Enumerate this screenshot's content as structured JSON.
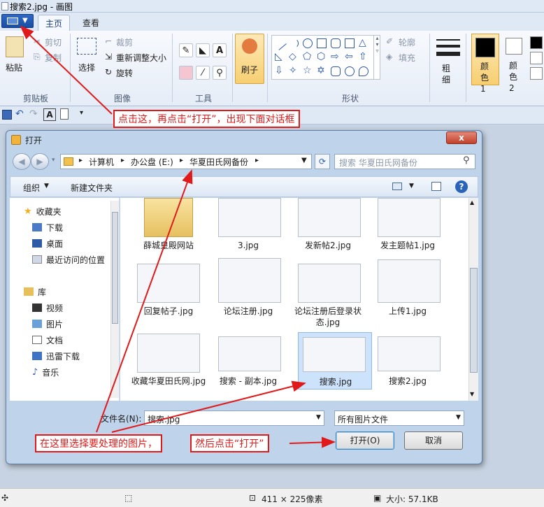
{
  "window": {
    "title": "搜索2.jpg - 画图"
  },
  "ribbon": {
    "tabs": [
      "主页",
      "查看"
    ],
    "clipboard": {
      "paste": "粘贴",
      "cut": "剪切",
      "copy": "复制",
      "label": "剪贴板"
    },
    "image": {
      "select": "选择",
      "crop": "裁剪",
      "resize": "重新调整大小",
      "rotate": "旋转",
      "label": "图像"
    },
    "tools": {
      "label": "工具"
    },
    "brushes": {
      "label": "刷子"
    },
    "shapes": {
      "outline": "轮廓",
      "fill": "填充",
      "label": "形状"
    },
    "size": {
      "label": "粗细"
    },
    "color1": {
      "label": "颜色 1"
    },
    "color2": {
      "label": "颜色 2"
    }
  },
  "annotations": {
    "top": "点击这，再点击“打开”，出现下面对话框",
    "bottom_left": "在这里选择要处理的图片，",
    "bottom_right": "然后点击“打开”"
  },
  "dialog": {
    "title": "打开",
    "close": "x",
    "breadcrumb": [
      "计算机",
      "办公盘 (E:)",
      "华夏田氏网备份"
    ],
    "search_placeholder": "搜索 华夏田氏网备份",
    "organize": "组织",
    "new_folder": "新建文件夹",
    "nav": {
      "favorites": "收藏夹",
      "downloads": "下载",
      "desktop": "桌面",
      "recent": "最近访问的位置",
      "libraries": "库",
      "videos": "视频",
      "pictures": "图片",
      "documents": "文档",
      "thunder": "迅雷下载",
      "music": "音乐"
    },
    "files": [
      {
        "name": "薛城皇殿网站"
      },
      {
        "name": "3.jpg"
      },
      {
        "name": "发新帖2.jpg"
      },
      {
        "name": "发主题帖1.jpg"
      },
      {
        "name": "回复帖子.jpg"
      },
      {
        "name": "论坛注册.jpg"
      },
      {
        "name": "论坛注册后登录状态.jpg"
      },
      {
        "name": "上传1.jpg"
      },
      {
        "name": "收藏华夏田氏网.jpg"
      },
      {
        "name": "搜索 - 副本.jpg"
      },
      {
        "name": "搜索.jpg"
      },
      {
        "name": "搜索2.jpg"
      }
    ],
    "filename_label": "文件名(N):",
    "filename_value": "搜索.jpg",
    "filetype": "所有图片文件",
    "open": "打开(O)",
    "cancel": "取消"
  },
  "status": {
    "dims": "411 × 225像素",
    "size": "大小: 57.1KB"
  },
  "colors": {
    "annotation": "#e01a1a",
    "accent": "#1f5ab6"
  }
}
